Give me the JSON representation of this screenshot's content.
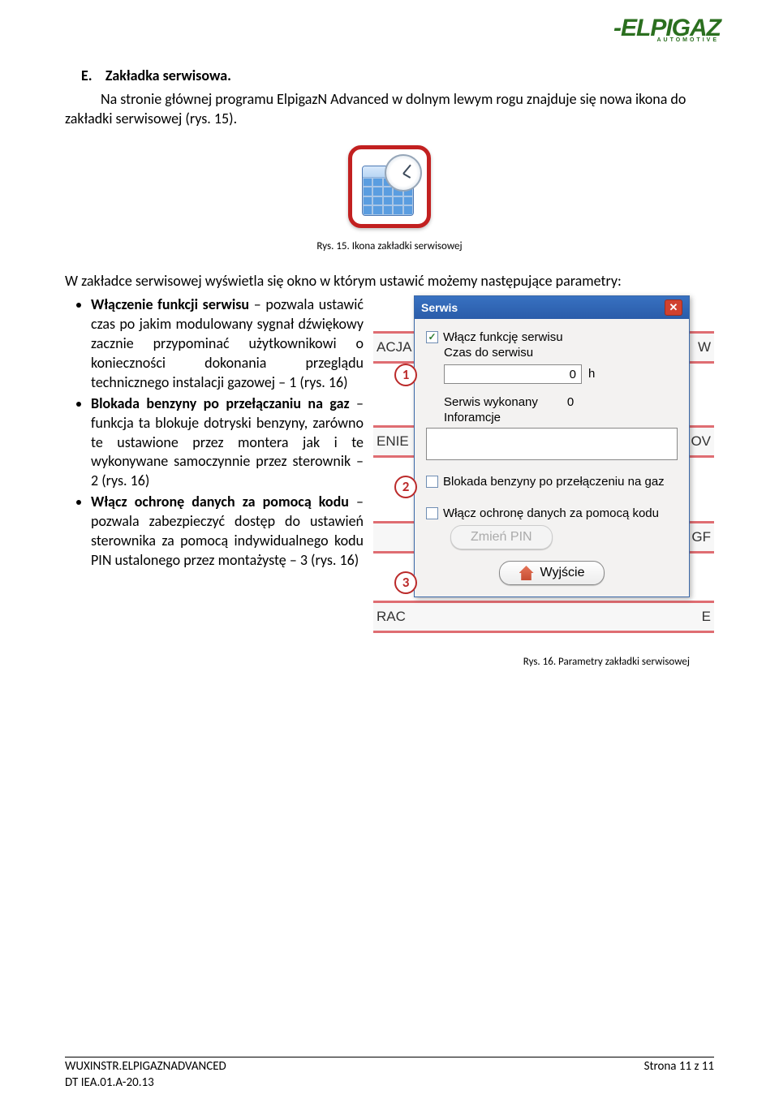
{
  "logo": {
    "brand": "-ELPIGAZ",
    "sub": "AUTOMOTIVE"
  },
  "section": {
    "marker": "E.",
    "title": "Zakładka serwisowa."
  },
  "intro": "Na stronie głównej programu ElpigazN Advanced w dolnym lewym rogu znajduje się nowa ikona do zakładki serwisowej (rys. 15).",
  "fig1_caption": "Rys. 15. Ikona zakładki serwisowej",
  "subintro": "W zakładce serwisowej wyświetla się okno w którym ustawić możemy następujące parametry:",
  "bullets": [
    {
      "bold": "Włączenie funkcji serwisu",
      "rest": " – pozwala ustawić czas po jakim modulowany sygnał dźwiękowy zacznie przypominać użytkownikowi o konieczności dokonania przeglądu technicznego instalacji gazowej – 1 (rys. 16)"
    },
    {
      "bold": "Blokada benzyny po przełączaniu na gaz",
      "rest": " – funkcja ta blokuje dotryski benzyny, zarówno te ustawione przez montera jak i te wykonywane samoczynnie przez sterownik – 2 (rys. 16)"
    },
    {
      "bold": "Włącz ochronę danych za pomocą kodu",
      "rest": " – pozwala zabezpieczyć dostęp do ustawień sterownika za pomocą indywidualnego kodu PIN ustalonego przez montażystę – 3 (rys. 16)"
    }
  ],
  "dialog": {
    "title": "Serwis",
    "enable_service": "Włącz funkcję serwisu",
    "time_to_service": "Czas do serwisu",
    "time_value": "0",
    "time_unit": "h",
    "service_done_label": "Serwis wykonany",
    "service_done_value": "0",
    "info_label": "Inforamcje",
    "block_petrol": "Blokada benzyny po przełączeniu na gaz",
    "enable_pin": "Włącz ochronę danych za pomocą kodu",
    "change_pin": "Zmień PIN",
    "exit": "Wyjście"
  },
  "bg_tabs": {
    "row1_l": "ACJA",
    "row1_r": "W",
    "row2_l": "ENIE",
    "row2_r": "OV",
    "row3_l": "",
    "row3_r": "GF",
    "row4_l": "RAC",
    "row4_r": "E"
  },
  "callouts": {
    "c1": "1",
    "c2": "2",
    "c3": "3"
  },
  "fig2_caption": "Rys. 16. Parametry zakładki serwisowej",
  "footer": {
    "left1": "WUXINSTR.ELPIGAZNADVANCED",
    "left2": "DT IEA.01.A-20.13",
    "right": "Strona 11 z 11"
  }
}
